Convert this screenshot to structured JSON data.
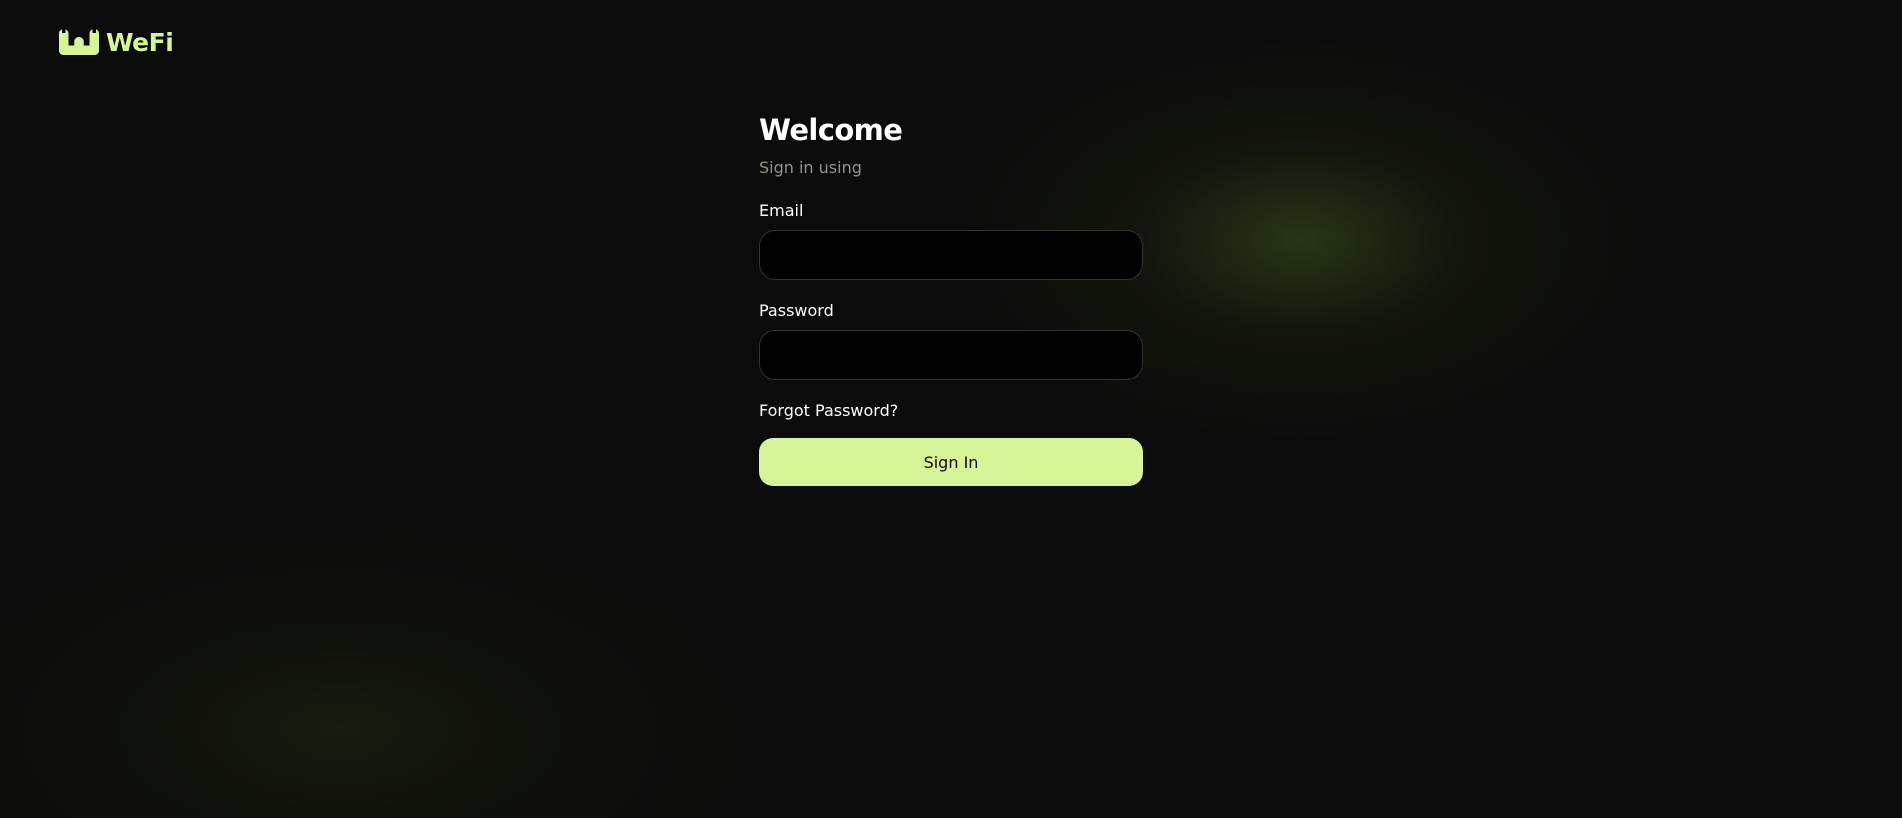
{
  "brand": {
    "name": "WeFi",
    "logo_icon": "wefi-w-logo-icon",
    "accent_color": "#d6f599"
  },
  "login": {
    "title": "Welcome",
    "subtitle": "Sign in using",
    "email_label": "Email",
    "email_value": "",
    "password_label": "Password",
    "password_value": "",
    "forgot_password": "Forgot Password?",
    "sign_in": "Sign In"
  },
  "colors": {
    "background": "#0b0b0b",
    "input_background": "#000000",
    "input_border": "#2e3334",
    "subtitle": "#8e9685",
    "button": "#d6f599"
  }
}
